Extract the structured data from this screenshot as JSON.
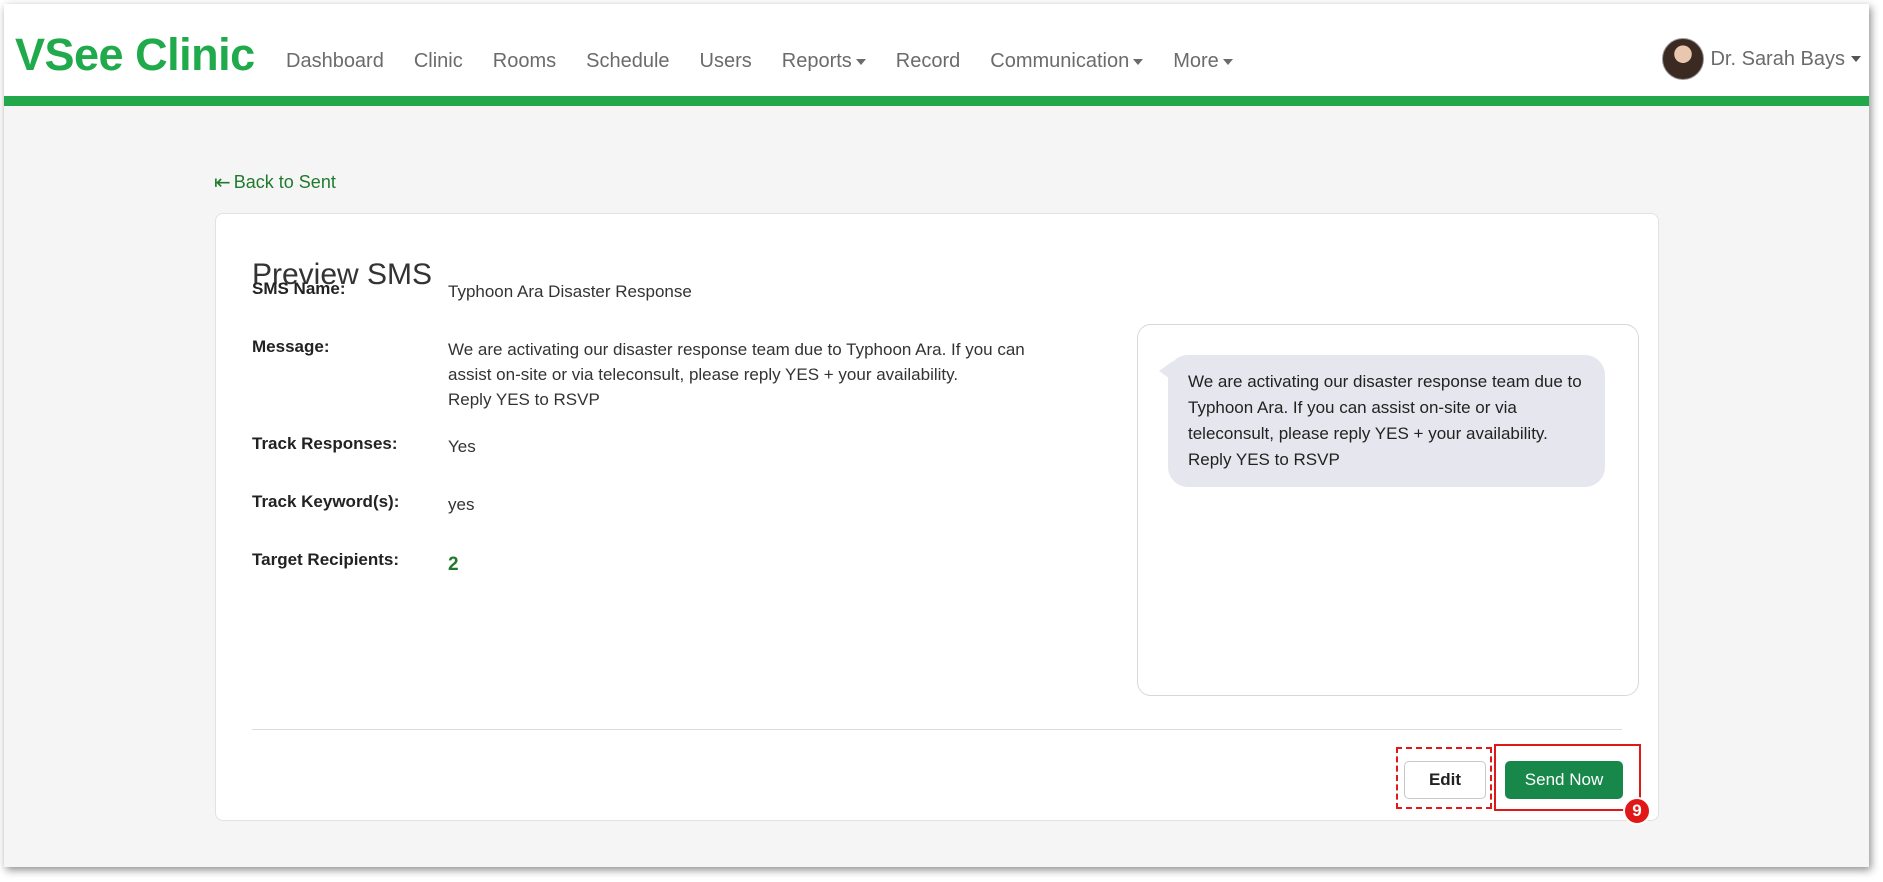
{
  "app": {
    "logo": "VSee Clinic"
  },
  "nav": {
    "items": [
      {
        "label": "Dashboard",
        "dropdown": false
      },
      {
        "label": "Clinic",
        "dropdown": false
      },
      {
        "label": "Rooms",
        "dropdown": false
      },
      {
        "label": "Schedule",
        "dropdown": false
      },
      {
        "label": "Users",
        "dropdown": false
      },
      {
        "label": "Reports",
        "dropdown": true
      },
      {
        "label": "Record",
        "dropdown": false
      },
      {
        "label": "Communication",
        "dropdown": true
      },
      {
        "label": "More",
        "dropdown": true
      }
    ],
    "user_name": "Dr. Sarah Bays"
  },
  "back_link": {
    "icon": "back-arrow-icon",
    "label": "Back to Sent"
  },
  "preview": {
    "title": "Preview SMS",
    "fields": {
      "sms_name": {
        "label": "SMS Name:",
        "value": "Typhoon Ara Disaster Response"
      },
      "message": {
        "label": "Message:",
        "value": "We are activating our disaster response team due to Typhoon Ara. If you can assist on-site or via teleconsult, please reply YES + your availability.\nReply YES to RSVP"
      },
      "track_responses": {
        "label": "Track Responses:",
        "value": "Yes"
      },
      "track_keywords": {
        "label": "Track Keyword(s):",
        "value": "yes"
      },
      "target_recipients": {
        "label": "Target Recipients:",
        "value": "2"
      }
    },
    "bubble_text": "We are activating our disaster response team due to Typhoon Ara. If you can assist on-site or via teleconsult, please reply YES + your availability.\nReply YES to RSVP"
  },
  "actions": {
    "edit_label": "Edit",
    "send_label": "Send Now",
    "step_number": "9"
  },
  "colors": {
    "brand_green": "#20aa4b",
    "button_green": "#17874a",
    "link_green": "#1f7a2e",
    "highlight_red": "#e01818"
  }
}
